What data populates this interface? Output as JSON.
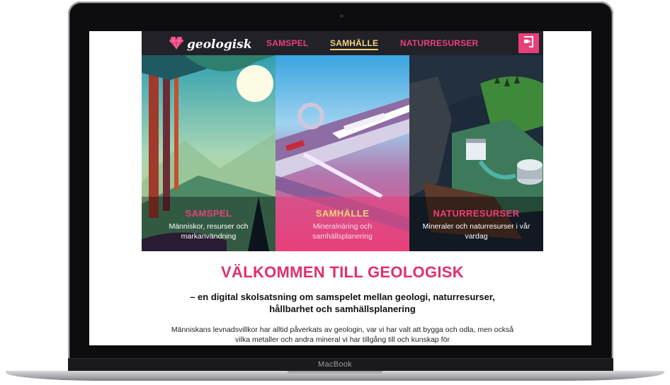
{
  "site": {
    "logo_text": "geologisk",
    "nav": [
      {
        "label": "SAMSPEL",
        "active": false
      },
      {
        "label": "SAMHÄLLE",
        "active": true
      },
      {
        "label": "NATURRESURSER",
        "active": false
      }
    ]
  },
  "panels": [
    {
      "title": "SAMSPEL",
      "subtitle": "Människor, resurser och markanvändning",
      "title_color": "#e8407a"
    },
    {
      "title": "SAMHÄLLE",
      "subtitle": "Mineralnäring och samhällsplanering",
      "title_color": "#f0d27a"
    },
    {
      "title": "NATURRESURSER",
      "subtitle": "Mineraler och naturresurser i vår vardag",
      "title_color": "#e8407a"
    }
  ],
  "content": {
    "welcome": "VÄLKOMMEN TILL GEOLOGISK",
    "subtitle": "– en digital skolsatsning om samspelet mellan geologi, naturresurser, hållbarhet och samhällsplanering",
    "body": "Människans levnadsvillkor har alltid påverkats av geologin, var vi har valt att bygga och odla, men också vilka metaller och andra mineral vi har tillgång till och kunskap för"
  },
  "device": {
    "label": "MacBook"
  },
  "colors": {
    "accent": "#e8407a",
    "active_nav": "#f0d27a",
    "nav_bg": "#222128"
  }
}
